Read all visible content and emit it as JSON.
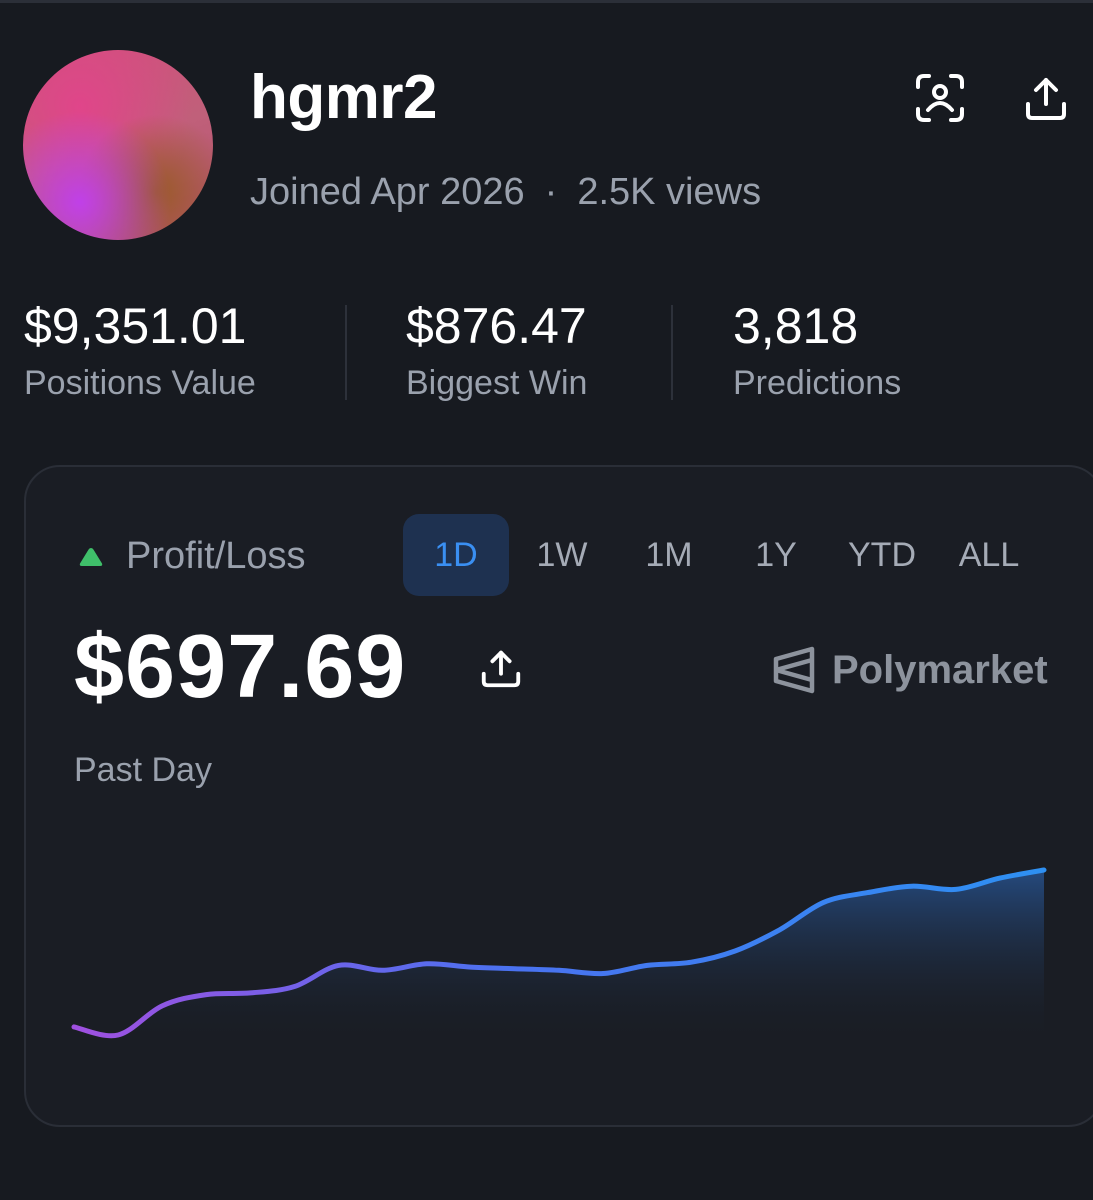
{
  "profile": {
    "username": "hgmr2",
    "joined": "Joined Apr 2026",
    "separator": "·",
    "views": "2.5K views"
  },
  "header_actions": {
    "scan_icon": "scan-user-icon",
    "share_icon": "share-upload-icon"
  },
  "stats": [
    {
      "value": "$9,351.01",
      "label": "Positions Value"
    },
    {
      "value": "$876.47",
      "label": "Biggest Win"
    },
    {
      "value": "3,818",
      "label": "Predictions"
    }
  ],
  "pnl_card": {
    "label": "Profit/Loss",
    "trend_icon": "triangle-up-icon",
    "trend_color": "#3fbf6a",
    "value": "$697.69",
    "period": "Past Day",
    "brand": "Polymarket",
    "tabs": [
      {
        "label": "1D",
        "active": true
      },
      {
        "label": "1W",
        "active": false
      },
      {
        "label": "1M",
        "active": false
      },
      {
        "label": "1Y",
        "active": false
      },
      {
        "label": "YTD",
        "active": false
      },
      {
        "label": "ALL",
        "active": false
      }
    ],
    "accent_color": "#3a8ff2",
    "line_gradient": [
      "#a050e0",
      "#4a72f0",
      "#2e90f2"
    ]
  },
  "chart_data": {
    "type": "area",
    "title": "",
    "xlabel": "",
    "ylabel": "",
    "grid": false,
    "values": [
      20,
      15,
      33,
      40,
      41,
      45,
      58,
      55,
      59,
      57,
      56,
      55,
      53,
      58,
      60,
      67,
      80,
      97,
      103,
      107,
      105,
      112,
      117
    ]
  }
}
